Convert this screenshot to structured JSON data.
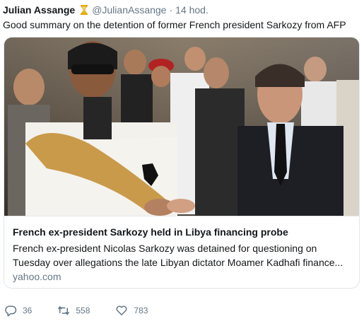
{
  "tweet": {
    "author_name": "Julian Assange",
    "handle": "@JulianAssange",
    "separator": "·",
    "time": "14 hod.",
    "text": "Good summary on the detention of former French president Sarkozy from AFP"
  },
  "card": {
    "image_icon": "news-photo",
    "title": "French ex-president Sarkozy held in Libya financing probe",
    "description_line1": "French ex-president Nicolas Sarkozy was detained for questioning on",
    "description_line2": "Tuesday over allegations the late Libyan dictator Moamer Kadhafi finance...",
    "domain": "yahoo.com"
  },
  "actions": {
    "reply_count": "36",
    "retweet_count": "558",
    "like_count": "783",
    "reply_icon": "reply-icon",
    "retweet_icon": "retweet-icon",
    "like_icon": "heart-icon"
  },
  "colors": {
    "text": "#14171a",
    "secondary": "#657786",
    "border": "#e1e8ed",
    "hourglass": "#e6a700"
  }
}
